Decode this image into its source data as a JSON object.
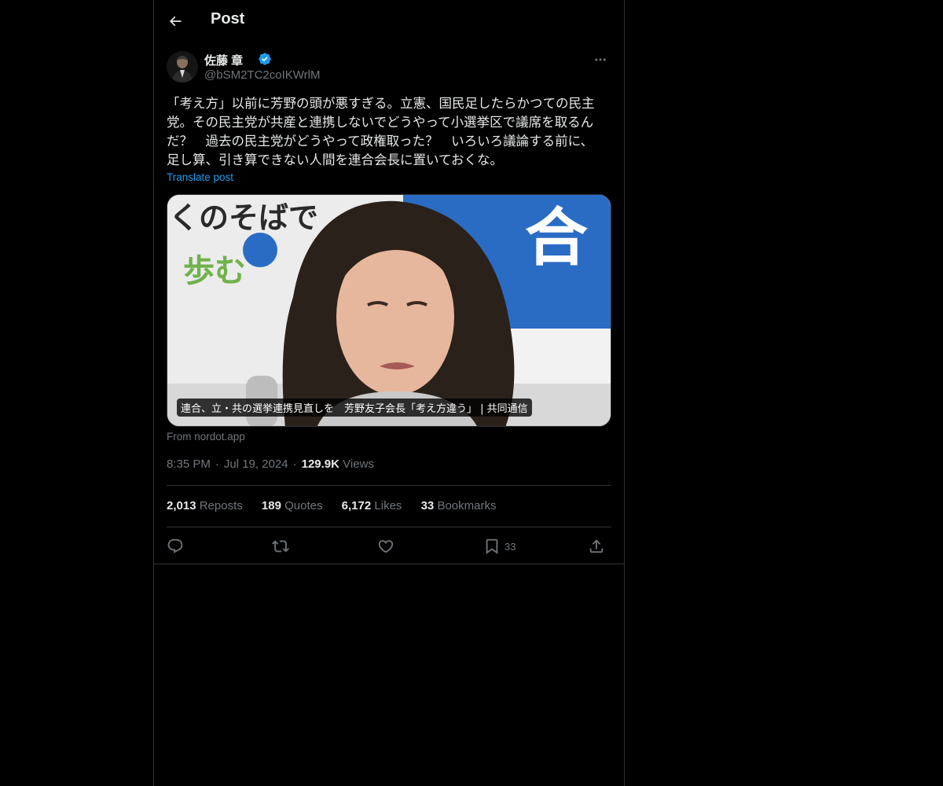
{
  "header": {
    "title": "Post",
    "back_icon": "back-arrow-icon"
  },
  "author": {
    "display_name": "佐藤 章",
    "handle": "@bSM2TC2coIKWrlM",
    "verified_icon": "verified-badge-icon",
    "verified_color": "#1d9bf0"
  },
  "post": {
    "text": "「考え方」以前に芳野の頭が悪すぎる。立憲、国民足したらかつての民主\n党。その民主党が共産と連携しないでどうやって小選挙区で議席を取るん\nだ？　過去の民主党がどうやって政権取った？　いろいろ議論する前に、\n足し算、引き算できない人間を連合会長に置いておくな。",
    "translate_label": "Translate post"
  },
  "card": {
    "caption": "連合、立・共の選挙連携見直しを　芳野友子会長「考え方違う」 | 共同通信",
    "source": "From nordot.app",
    "bg_text_left_1": "くのそばで",
    "bg_text_left_2": "歩む",
    "bg_text_right": "合"
  },
  "meta": {
    "time": "8:35 PM",
    "date": "Jul 19, 2024",
    "views_count": "129.9K",
    "views_label": "Views"
  },
  "stats": {
    "reposts_count": "2,013",
    "reposts_label": "Reposts",
    "quotes_count": "189",
    "quotes_label": "Quotes",
    "likes_count": "6,172",
    "likes_label": "Likes",
    "bookmarks_count": "33",
    "bookmarks_label": "Bookmarks"
  },
  "actions": {
    "reply_icon": "reply-icon",
    "repost_icon": "repost-icon",
    "like_icon": "heart-icon",
    "bookmark_icon": "bookmark-icon",
    "bookmark_count": "33",
    "share_icon": "share-icon"
  },
  "colors": {
    "background": "#000000",
    "text_primary": "#e7e9ea",
    "text_secondary": "#71767b",
    "accent": "#1d9bf0",
    "border": "#2f3336"
  }
}
